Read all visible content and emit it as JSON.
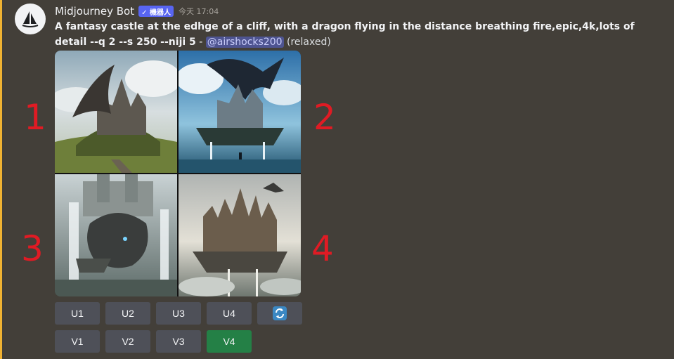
{
  "author": {
    "name": "Midjourney Bot",
    "badge": "✓ 機器人",
    "timestamp": "今天 17:04"
  },
  "message": {
    "prompt": "A fantasy castle at the edhge of a cliff, with a dragon flying in the distance breathing fire,epic,4k,lots of detail --q 2 --s 250 --niji 5",
    "separator": " - ",
    "mention": "@airshocks200",
    "mode": "(relaxed)"
  },
  "annotations": [
    "1",
    "2",
    "3",
    "4"
  ],
  "buttons": {
    "upscale": [
      "U1",
      "U2",
      "U3",
      "U4"
    ],
    "variation": [
      "V1",
      "V2",
      "V3",
      "V4"
    ]
  },
  "colors": {
    "accent_bar": "#f0b232",
    "annotation": "#e01b24",
    "active_button": "#248046",
    "mention_bg": "#4e5491"
  },
  "icons": {
    "avatar": "sailboat-icon",
    "reroll": "refresh-icon",
    "badge": "checkmark-icon"
  }
}
